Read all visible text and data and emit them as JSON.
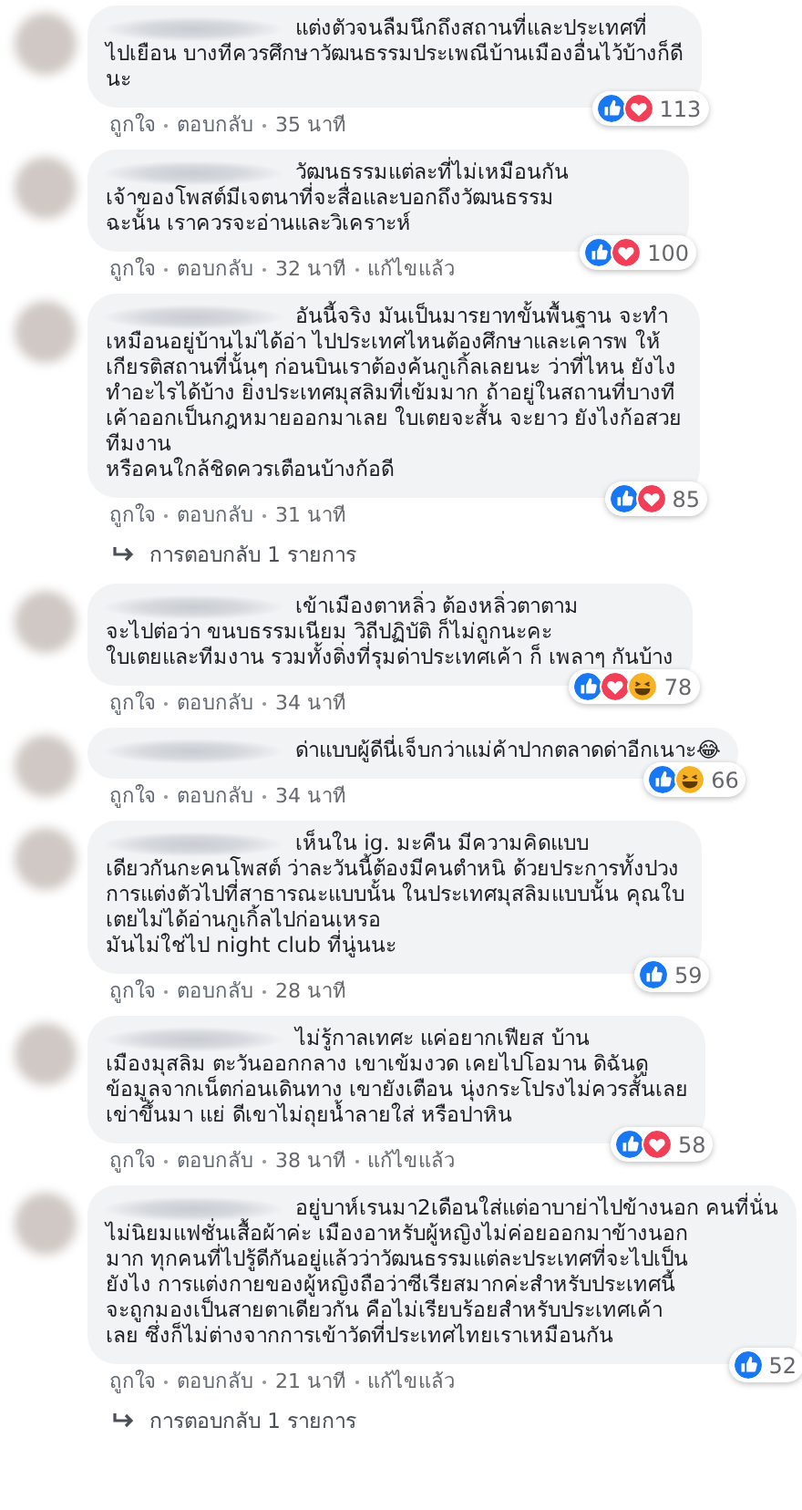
{
  "comments": [
    {
      "text": "แต่งตัวจนลืมนึกถึงสถานที่และประเทศที่\nไปเยือน บางทีควรศึกษาวัฒนธรรมประเพณีบ้านเมืองอื่นไว้บ้างก็ดี\nนะ",
      "reactions": [
        {
          "kind": "like"
        },
        {
          "kind": "love"
        }
      ],
      "reaction_count": "113",
      "actions": [
        "ถูกใจ",
        "ตอบกลับ"
      ],
      "time": "35 นาที"
    },
    {
      "text": "วัฒนธรรมแต่ละที่ไม่เหมือนกัน\nเจ้าของโพสต์มีเจตนาที่จะสื่อและบอกถึงวัฒนธรรม\nฉะนั้น เราควรจะอ่านและวิเคราะห์",
      "reactions": [
        {
          "kind": "like"
        },
        {
          "kind": "love"
        }
      ],
      "reaction_count": "100",
      "actions": [
        "ถูกใจ",
        "ตอบกลับ"
      ],
      "time": "32 นาที",
      "edited": "แก้ไขแล้ว"
    },
    {
      "text": "อันนี้จริง มันเป็นมารยาทขั้นพื้นฐาน จะทำ\nเหมือนอยู่บ้านไม่ได้อ่า ไปประเทศไหนต้องศึกษาและเคารพ ให้\nเกียรติสถานที่นั้นๆ ก่อนบินเราต้องค้นกูเกิ้ลเลยนะ ว่าที่ไหน ยังไง\nทำอะไรได้บ้าง ยิ่งประเทศมุสลิมที่เข้มมาก ถ้าอยู่ในสถานที่บางที\nเค้าออกเป็นกฎหมายออกมาเลย ใบเตยจะสั้น จะยาว ยังไงก้อสวย\nทีมงาน\nหรือคนใกล้ชิดควรเตือนบ้างก้อดี",
      "reactions": [
        {
          "kind": "like"
        },
        {
          "kind": "love"
        }
      ],
      "reaction_count": "85",
      "actions": [
        "ถูกใจ",
        "ตอบกลับ"
      ],
      "time": "31 นาที",
      "replies": "การตอบกลับ 1 รายการ"
    },
    {
      "text": "เข้าเมืองตาหลิ่ว ต้องหลิ่วตาตาม\nจะไปต่อว่า ขนบธรรมเนียม วิถีปฏิบัติ ก็ไม่ถูกนะคะ\nใบเตยและทีมงาน รวมทั้งติ่งที่รุมด่าประเทศเค้า ก็ เพลาๆ กันบ้าง",
      "reactions": [
        {
          "kind": "like"
        },
        {
          "kind": "love"
        },
        {
          "kind": "haha"
        }
      ],
      "reaction_count": "78",
      "actions": [
        "ถูกใจ",
        "ตอบกลับ"
      ],
      "time": "34 นาที"
    },
    {
      "text": "ด่าแบบผู้ดีนี่เจ็บกว่าแม่ค้าปากตลาดด่าอีกเนาะ😂",
      "reactions": [
        {
          "kind": "like"
        },
        {
          "kind": "haha"
        }
      ],
      "reaction_count": "66",
      "actions": [
        "ถูกใจ",
        "ตอบกลับ"
      ],
      "time": "34 นาที"
    },
    {
      "text": "เห็นใน ig. มะคืน มีความคิดแบบ\nเดียวกันกะคนโพสต์ ว่าละวันนี้ต้องมีคนตำหนิ ด้วยประการทั้งปวง\nการแต่งตัวไปที่สาธารณะแบบนั้น ในประเทศมุสลิมแบบนั้น คุณใบ\nเตยไม่ได้อ่านกูเกิ้ลไปก่อนเหรอ\nมันไม่ใช่ไป night club ที่นู่นนะ",
      "reactions": [
        {
          "kind": "like"
        }
      ],
      "reaction_count": "59",
      "actions": [
        "ถูกใจ",
        "ตอบกลับ"
      ],
      "time": "28 นาที"
    },
    {
      "text": "ไม่รู้กาลเทศะ แค่อยากเฟียส บ้าน\nเมืองมุสลิม ตะวันออกกลาง เขาเข้มงวด เคยไปโอมาน ดิฉันดู\nข้อมูลจากเน็ตก่อนเดินทาง เขายังเตือน นุ่งกระโปรงไม่ควรสั้นเลย\nเข่าขึ้นมา แย่ ดีเขาไม่ถุยน้ำลายใส่ หรือปาหิน",
      "reactions": [
        {
          "kind": "like"
        },
        {
          "kind": "love"
        }
      ],
      "reaction_count": "58",
      "actions": [
        "ถูกใจ",
        "ตอบกลับ"
      ],
      "time": "38 นาที",
      "edited": "แก้ไขแล้ว"
    },
    {
      "text": "อยู่บาห์เรนมา2เดือนใส่แต่อาบาย่าไปข้างนอก คนที่นั่น\nไม่นิยมแฟชั่นเสื้อผ้าค่ะ เมืองอาหรับผู้หญิงไม่ค่อยออกมาข้างนอก\nมาก ทุกคนที่ไปรู้ดีกันอยู่แล้วว่าวัฒนธรรมแต่ละประเทศที่จะไปเป็น\nยังไง การแต่งกายของผู้หญิงถือว่าซีเรียสมากค่ะสำหรับประเทศนี้\nจะถูกมองเป็นสายตาเดียวกัน คือไม่เรียบร้อยสำหรับประเทศเค้า\nเลย ซึ่งก็ไม่ต่างจากการเข้าวัดที่ประเทศไทยเราเหมือนกัน",
      "reactions": [
        {
          "kind": "like"
        }
      ],
      "reaction_count": "52",
      "actions": [
        "ถูกใจ",
        "ตอบกลับ"
      ],
      "time": "21 นาที",
      "edited": "แก้ไขแล้ว",
      "replies": "การตอบกลับ 1 รายการ"
    }
  ]
}
